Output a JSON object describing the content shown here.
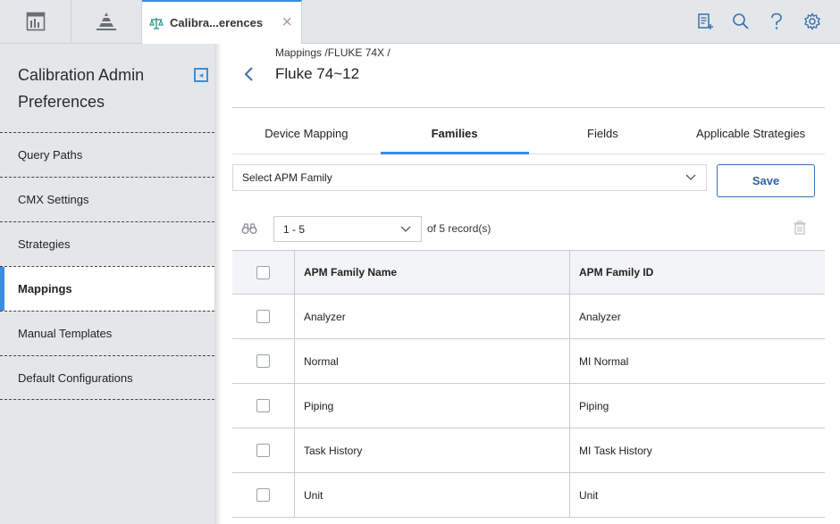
{
  "app": {
    "tab_label": "Calibra...erences"
  },
  "sidebar": {
    "title": "Calibration Admin Preferences",
    "items": [
      {
        "label": "Query Paths"
      },
      {
        "label": "CMX Settings"
      },
      {
        "label": "Strategies"
      },
      {
        "label": "Mappings",
        "active": true
      },
      {
        "label": "Manual Templates"
      },
      {
        "label": "Default Configurations"
      }
    ]
  },
  "main": {
    "breadcrumb": "Mappings /FLUKE 74X /",
    "title": "Fluke 74~12",
    "tabs": [
      {
        "label": "Device Mapping"
      },
      {
        "label": "Families",
        "active": true
      },
      {
        "label": "Fields"
      },
      {
        "label": "Applicable Strategies"
      }
    ],
    "family_select_placeholder": "Select APM Family",
    "save_label": "Save",
    "range_value": "1 - 5",
    "of_label": "of",
    "record_count": "5",
    "record_label": "record(s)",
    "table": {
      "columns": [
        "APM Family Name",
        "APM Family ID"
      ],
      "rows": [
        {
          "name": "Analyzer",
          "id": "Analyzer"
        },
        {
          "name": "Normal",
          "id": "MI Normal"
        },
        {
          "name": "Piping",
          "id": "Piping"
        },
        {
          "name": "Task History",
          "id": "MI Task History"
        },
        {
          "name": "Unit",
          "id": "Unit"
        }
      ]
    }
  },
  "colors": {
    "accent": "#3a8de0",
    "sidebar_bg": "#e4e7ea"
  },
  "icons": [
    "dashboard-icon",
    "pyramid-icon",
    "scale-icon",
    "close-icon",
    "notes-add-icon",
    "search-icon",
    "help-icon",
    "gear-icon",
    "collapse-icon",
    "back-icon",
    "chevron-down-icon",
    "binoculars-icon",
    "trash-icon"
  ]
}
